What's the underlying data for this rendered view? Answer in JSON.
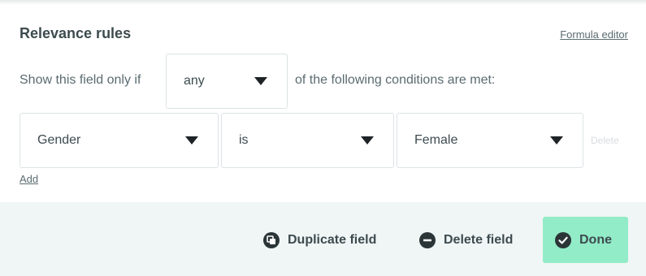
{
  "relevance": {
    "title": "Relevance rules",
    "formula_editor_label": "Formula editor",
    "show_prefix": "Show this field only if",
    "match_mode": "any",
    "show_suffix": "of the following conditions are met:"
  },
  "conditions": [
    {
      "field": "Gender",
      "operator": "is",
      "value": "Female",
      "delete_label": "Delete"
    }
  ],
  "add_label": "Add",
  "footer": {
    "duplicate_label": "Duplicate field",
    "delete_label": "Delete field",
    "done_label": "Done",
    "duplicate_icon": "duplicate-icon",
    "delete_icon": "minus-circle-icon",
    "done_icon": "check-circle-icon"
  },
  "colors": {
    "accent": "#92ecc7",
    "footer_bg": "#f0f5f5",
    "text": "#3d4b4f"
  }
}
